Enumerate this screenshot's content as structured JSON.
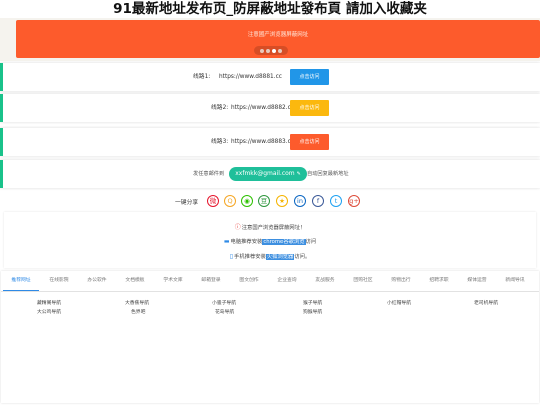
{
  "page": {
    "title": "91最新地址发布页_防屏蔽地址發布頁 請加入收藏夹"
  },
  "banner": {
    "notice": "注意國产浏览器屏蔽网址",
    "dots": 4,
    "active_dot": 3,
    "bg": "#fd5b2c"
  },
  "lines": [
    {
      "label": "线路1:",
      "url": "https://www.d8881.cc",
      "button": "点击访问",
      "color": "#2196e8"
    },
    {
      "label": "线路2:",
      "url": "https://www.d8882.cc",
      "button": "点击访问",
      "color": "#fbb80e"
    },
    {
      "label": "线路3:",
      "url": "https://www.d8883.cc",
      "button": "点击访问",
      "color": "#fd5b2c"
    }
  ],
  "email": {
    "prefix": "发任意邮件到",
    "address": "xxfmkk@gmail.com",
    "pencil": "✎",
    "suffix": "自动回复最新地址"
  },
  "share": {
    "label": "一键分享",
    "icons": [
      {
        "name": "weibo-icon",
        "glyph": "微",
        "color": "#e6162d"
      },
      {
        "name": "qzone-icon",
        "glyph": "Q",
        "color": "#f5a623"
      },
      {
        "name": "wechat-icon",
        "glyph": "◉",
        "color": "#2dc100"
      },
      {
        "name": "douban-icon",
        "glyph": "豆",
        "color": "#2e963d"
      },
      {
        "name": "star-icon",
        "glyph": "★",
        "color": "#f5b400"
      },
      {
        "name": "linkedin-icon",
        "glyph": "in",
        "color": "#0a66c2"
      },
      {
        "name": "facebook-icon",
        "glyph": "f",
        "color": "#3b5998"
      },
      {
        "name": "twitter-icon",
        "glyph": "t",
        "color": "#1da1f2"
      },
      {
        "name": "googleplus-icon",
        "glyph": "g+",
        "color": "#dd4b39"
      }
    ]
  },
  "notices": {
    "line1": "注意国产浏览器屏蔽网址！",
    "line2_pre": "电脑推荐安装",
    "line2_hl": "chrome谷歌浏览",
    "line2_post": "访问",
    "line3_pre": "手机推荐安装",
    "line3_hl": "火狐浏览器",
    "line3_post": "访问。"
  },
  "tabs": [
    "推荐网址",
    "在线影院",
    "办公软件",
    "文档模板",
    "学术文库",
    "邮箱登录",
    "图文创作",
    "企业查询",
    "友战服务",
    "团购社区",
    "购物出行",
    "招聘求职",
    "媒体运营",
    "新闻导讯"
  ],
  "active_tab": 0,
  "links": [
    [
      "藏精阁导航",
      "大香蕉导航",
      "小骚子导航",
      "猴子导航",
      "小红帽导航",
      "老司机导航"
    ],
    [
      "大公鸡导航",
      "色界吧",
      "花岛导航",
      "狗猴导航"
    ]
  ]
}
